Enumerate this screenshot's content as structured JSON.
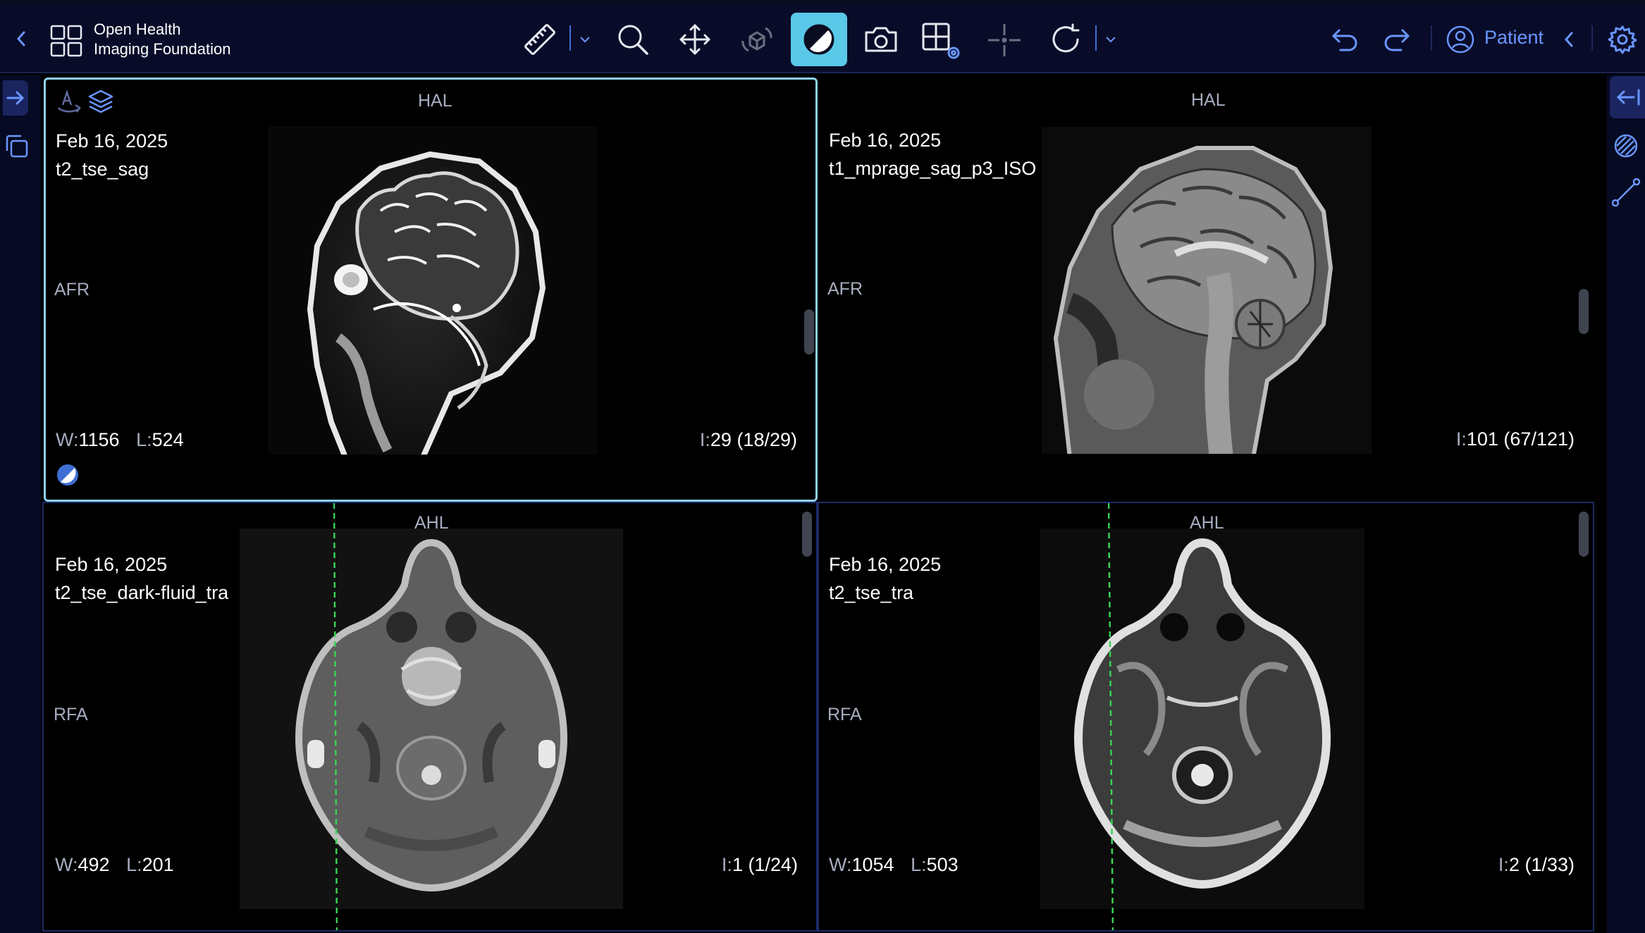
{
  "header": {
    "logo_line1": "Open Health",
    "logo_line2": "Imaging Foundation",
    "patient_label": "Patient",
    "tools": [
      {
        "icon": "ruler-icon"
      },
      {
        "icon": "magnifier-icon"
      },
      {
        "icon": "move-icon"
      },
      {
        "icon": "rotate-3d-icon"
      },
      {
        "icon": "contrast-icon"
      },
      {
        "icon": "camera-icon"
      },
      {
        "icon": "layout-settings-icon"
      },
      {
        "icon": "crosshair-icon"
      },
      {
        "icon": "reset-icon"
      }
    ],
    "accent_color": "#5ac8e8"
  },
  "viewports": [
    {
      "orientation_top": "HAL",
      "orientation_left": "AFR",
      "date": "Feb 16, 2025",
      "series": "t2_tse_sag",
      "w_label": "W:",
      "w_value": "1156",
      "l_label": "L:",
      "l_value": "524",
      "i_label": "I:",
      "i_value": "29 (18/29)"
    },
    {
      "orientation_top": "HAL",
      "orientation_left": "AFR",
      "date": "Feb 16, 2025",
      "series": "t1_mprage_sag_p3_ISO",
      "i_label": "I:",
      "i_value": "101 (67/121)"
    },
    {
      "orientation_top": "AHL",
      "orientation_left": "RFA",
      "date": "Feb 16, 2025",
      "series": "t2_tse_dark-fluid_tra",
      "w_label": "W:",
      "w_value": "492",
      "l_label": "L:",
      "l_value": "201",
      "i_label": "I:",
      "i_value": "1 (1/24)"
    },
    {
      "orientation_top": "AHL",
      "orientation_left": "RFA",
      "date": "Feb 16, 2025",
      "series": "t2_tse_tra",
      "w_label": "W:",
      "w_value": "1054",
      "l_label": "L:",
      "l_value": "503",
      "i_label": "I:",
      "i_value": "2 (1/33)"
    }
  ],
  "reference_line_color": "#39d353"
}
